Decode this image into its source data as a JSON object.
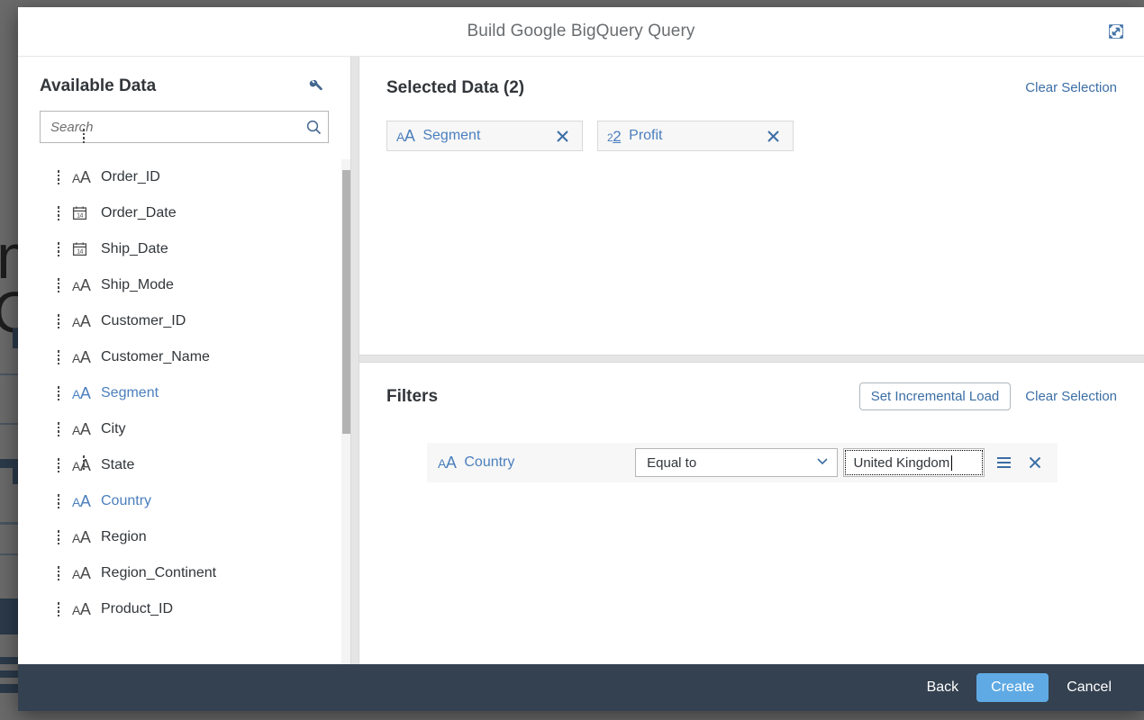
{
  "dialog": {
    "title": "Build Google BigQuery Query",
    "expand_icon": "expand-icon"
  },
  "available": {
    "title": "Available Data",
    "settings_icon": "wrench-icon",
    "search": {
      "placeholder": "Search",
      "value": "",
      "icon": "search-icon"
    },
    "fields": [
      {
        "label": "Order_ID",
        "type": "text",
        "selected": false
      },
      {
        "label": "Order_Date",
        "type": "date",
        "selected": false
      },
      {
        "label": "Ship_Date",
        "type": "date",
        "selected": false
      },
      {
        "label": "Ship_Mode",
        "type": "text",
        "selected": false
      },
      {
        "label": "Customer_ID",
        "type": "text",
        "selected": false
      },
      {
        "label": "Customer_Name",
        "type": "text",
        "selected": false
      },
      {
        "label": "Segment",
        "type": "text",
        "selected": true
      },
      {
        "label": "City",
        "type": "text",
        "selected": false
      },
      {
        "label": "State",
        "type": "text",
        "selected": false
      },
      {
        "label": "Country",
        "type": "text",
        "selected": true
      },
      {
        "label": "Region",
        "type": "text",
        "selected": false
      },
      {
        "label": "Region_Continent",
        "type": "text",
        "selected": false
      },
      {
        "label": "Product_ID",
        "type": "text",
        "selected": false
      }
    ]
  },
  "selected_data": {
    "title": "Selected Data (2)",
    "clear_label": "Clear Selection",
    "tokens": [
      {
        "label": "Segment",
        "type": "text"
      },
      {
        "label": "Profit",
        "type": "number"
      }
    ]
  },
  "filters": {
    "title": "Filters",
    "incremental_label": "Set Incremental Load",
    "clear_label": "Clear Selection",
    "rows": [
      {
        "field": "Country",
        "field_type": "text",
        "operator": "Equal to",
        "value": "United Kingdom",
        "value_help_icon": "list-icon",
        "remove_icon": "close-icon"
      }
    ]
  },
  "footer": {
    "back_label": "Back",
    "create_label": "Create",
    "cancel_label": "Cancel"
  },
  "colors": {
    "accent": "#3b6ea5",
    "primary_button": "#5faae4",
    "footer_bar": "#344150",
    "selected_field": "#4b7fbd"
  }
}
